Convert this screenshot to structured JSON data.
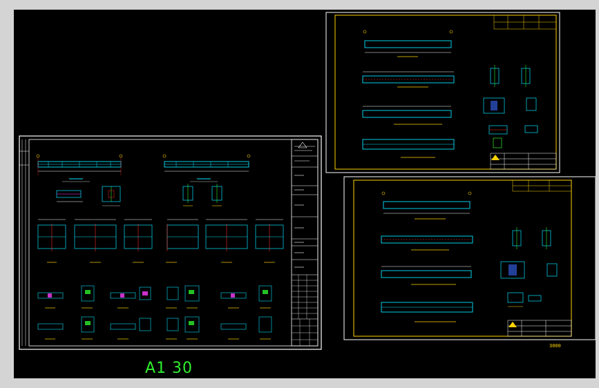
{
  "drawing": {
    "sheet_label": "A1 30",
    "corner_scale_note": "3000"
  },
  "colors": {
    "background": "#000000",
    "window_frame": "#d4d4d4",
    "sheet_border": "#ffffff",
    "sheet_border_yellow": "#ffd400",
    "beam": "#00e5ff",
    "dimension": "#ffffff",
    "hatch": "#3a6bff",
    "accent_red": "#ff2a2a",
    "accent_green": "#2ef02e",
    "accent_magenta": "#ff3cff",
    "label_cyan": "#00e5ff"
  }
}
